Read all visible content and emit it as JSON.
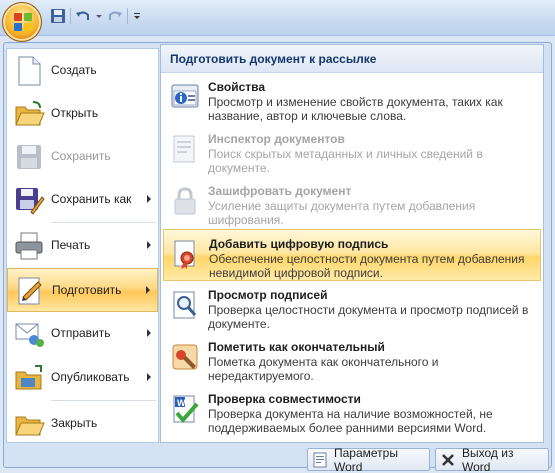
{
  "quick_access": {
    "save_icon": "save-icon",
    "undo_icon": "undo-icon",
    "redo_icon": "redo-icon",
    "customize_icon": "customize-qat-icon"
  },
  "left_menu": {
    "items": [
      {
        "label": "Создать",
        "icon": "new-document-icon",
        "enabled": true,
        "submenu": false
      },
      {
        "label": "Открыть",
        "icon": "open-folder-icon",
        "enabled": true,
        "submenu": false
      },
      {
        "label": "Сохранить",
        "icon": "save-disk-icon",
        "enabled": false,
        "submenu": false
      },
      {
        "label": "Сохранить как",
        "icon": "save-as-icon",
        "enabled": true,
        "submenu": true
      },
      {
        "label": "Печать",
        "icon": "printer-icon",
        "enabled": true,
        "submenu": true
      },
      {
        "label": "Подготовить",
        "icon": "prepare-icon",
        "enabled": true,
        "submenu": true,
        "active": true
      },
      {
        "label": "Отправить",
        "icon": "send-icon",
        "enabled": true,
        "submenu": true
      },
      {
        "label": "Опубликовать",
        "icon": "publish-icon",
        "enabled": true,
        "submenu": true
      },
      {
        "label": "Закрыть",
        "icon": "close-folder-icon",
        "enabled": true,
        "submenu": false
      }
    ]
  },
  "right_panel": {
    "header": "Подготовить документ к рассылке",
    "items": [
      {
        "title": "Свойства",
        "desc": "Просмотр и изменение свойств документа, таких как название, автор и ключевые слова.",
        "icon": "properties-icon",
        "enabled": true
      },
      {
        "title": "Инспектор документов",
        "desc": "Поиск скрытых метаданных и личных сведений в документе.",
        "icon": "inspect-document-icon",
        "enabled": false
      },
      {
        "title": "Зашифровать документ",
        "desc": "Усиление защиты документа путем добавления шифрования.",
        "icon": "encrypt-lock-icon",
        "enabled": false
      },
      {
        "title": "Добавить цифровую подпись",
        "desc": "Обеспечение целостности документа путем добавления невидимой цифровой подписи.",
        "icon": "digital-signature-icon",
        "enabled": true,
        "active": true
      },
      {
        "title": "Просмотр подписей",
        "desc": "Проверка целостности документа и просмотр подписей в документе.",
        "icon": "view-signatures-icon",
        "enabled": true
      },
      {
        "title": "Пометить как окончательный",
        "desc": "Пометка документа как окончательного и нередактируемого.",
        "icon": "mark-final-icon",
        "enabled": true
      },
      {
        "title": "Проверка совместимости",
        "desc": "Проверка документа на наличие возможностей, не поддерживаемых более ранними версиями Word.",
        "icon": "compatibility-check-icon",
        "enabled": true
      }
    ]
  },
  "bottom": {
    "options_label": "Параметры Word",
    "exit_label": "Выход из Word"
  }
}
